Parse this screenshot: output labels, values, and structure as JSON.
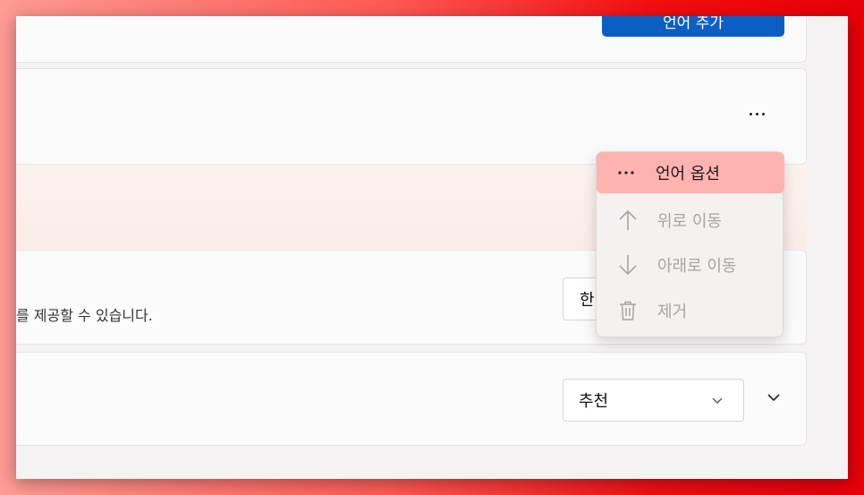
{
  "language_settings": {
    "add_language_label": "언어 추가",
    "more_options_icon": "more-horizontal-icon",
    "description": "를 제공할 수 있습니다.",
    "display_language_select_value": "한",
    "recommended_select_value": "추천"
  },
  "context_menu": {
    "items": [
      {
        "label": "언어 옵션",
        "icon": "more-horizontal-icon",
        "enabled": true,
        "selected": true
      },
      {
        "label": "위로 이동",
        "icon": "arrow-up-icon",
        "enabled": false
      },
      {
        "label": "아래로 이동",
        "icon": "arrow-down-icon",
        "enabled": false
      },
      {
        "label": "제거",
        "icon": "trash-icon",
        "enabled": false
      }
    ]
  },
  "colors": {
    "accent": "#0b5fc4",
    "menu_highlight": "#ffb3b1",
    "disabled_text": "#a8a4a4"
  }
}
